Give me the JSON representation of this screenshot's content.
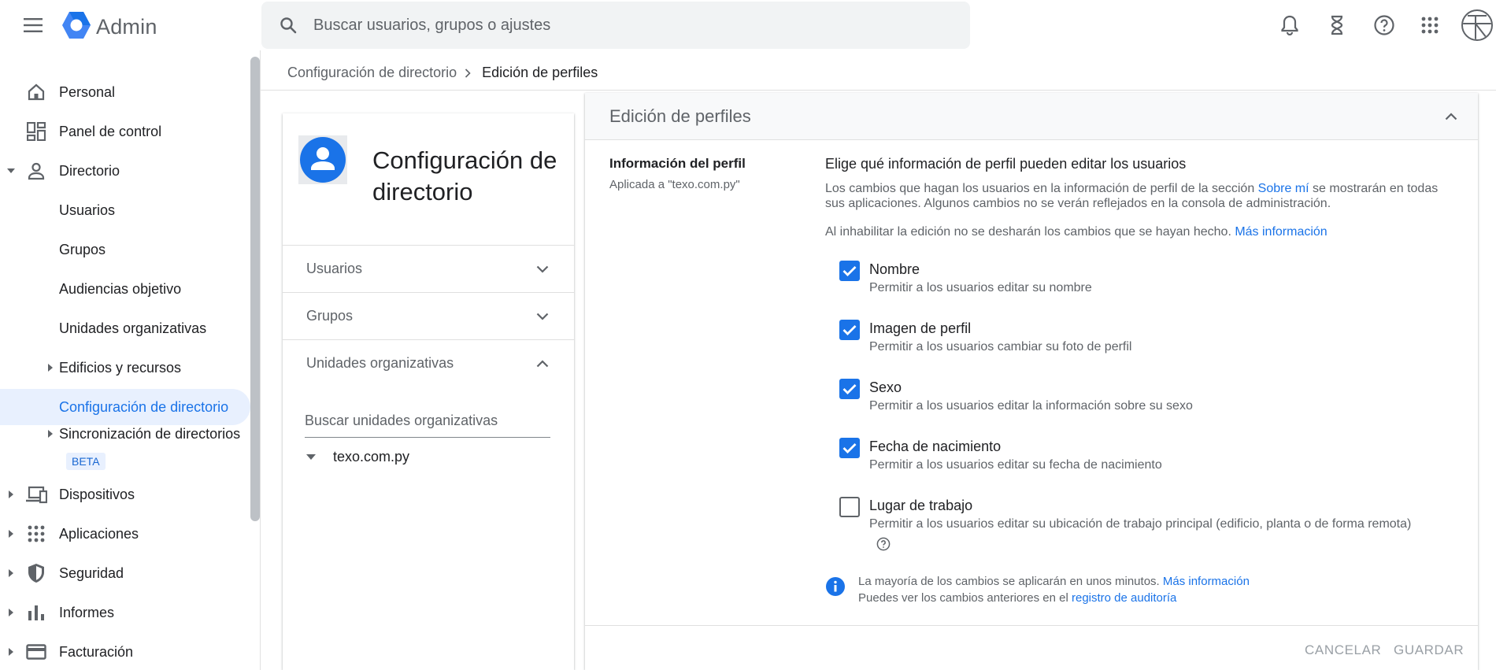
{
  "app": {
    "title": "Admin"
  },
  "search": {
    "placeholder": "Buscar usuarios, grupos o ajustes"
  },
  "sidebar": {
    "items": [
      {
        "label": "Personal"
      },
      {
        "label": "Panel de control"
      },
      {
        "label": "Directorio"
      },
      {
        "label": "Usuarios"
      },
      {
        "label": "Grupos"
      },
      {
        "label": "Audiencias objetivo"
      },
      {
        "label": "Unidades organizativas"
      },
      {
        "label": "Edificios y recursos"
      },
      {
        "label": "Configuración de directorio"
      },
      {
        "label": "Sincronización de directorios",
        "badge": "BETA"
      },
      {
        "label": "Dispositivos"
      },
      {
        "label": "Aplicaciones"
      },
      {
        "label": "Seguridad"
      },
      {
        "label": "Informes"
      },
      {
        "label": "Facturación"
      }
    ]
  },
  "breadcrumb": {
    "parent": "Configuración de directorio",
    "current": "Edición de perfiles"
  },
  "left_card": {
    "title": "Configuración de directorio",
    "sections": [
      {
        "label": "Usuarios"
      },
      {
        "label": "Grupos"
      },
      {
        "label": "Unidades organizativas"
      }
    ],
    "ou_search_placeholder": "Buscar unidades organizativas",
    "ou_root": "texo.com.py"
  },
  "panel": {
    "title": "Edición de perfiles",
    "setting_name": "Información del perfil",
    "setting_applied": "Aplicada a \"texo.com.py\"",
    "heading": "Elige qué información de perfil pueden editar los usuarios",
    "desc_before_link": "Los cambios que hagan los usuarios en la información de perfil de la sección ",
    "desc_link": "Sobre mí",
    "desc_after_link": " se mostrarán en todas sus aplicaciones. Algunos cambios no se verán reflejados en la consola de administración.",
    "desc2_text": "Al inhabilitar la edición no se desharán los cambios que se hayan hecho. ",
    "desc2_link": "Más información",
    "options": [
      {
        "label": "Nombre",
        "description": "Permitir a los usuarios editar su nombre",
        "checked": true
      },
      {
        "label": "Imagen de perfil",
        "description": "Permitir a los usuarios cambiar su foto de perfil",
        "checked": true
      },
      {
        "label": "Sexo",
        "description": "Permitir a los usuarios editar la información sobre su sexo",
        "checked": true
      },
      {
        "label": "Fecha de nacimiento",
        "description": "Permitir a los usuarios editar su fecha de nacimiento",
        "checked": true
      },
      {
        "label": "Lugar de trabajo",
        "description": "Permitir a los usuarios editar su ubicación de trabajo principal (edificio, planta o de forma remota)",
        "checked": false
      }
    ],
    "info_line1": "La mayoría de los cambios se aplicarán en unos minutos. ",
    "info_line1_link": "Más información",
    "info_line2": "Puedes ver los cambios anteriores en el ",
    "info_line2_link": "registro de auditoría",
    "cancel_label": "CANCELAR",
    "save_label": "GUARDAR"
  },
  "colors": {
    "accent": "#1a73e8",
    "active_bg": "#e8f0fe",
    "text_secondary": "#5f6368"
  },
  "icons": {
    "menu": "menu-icon",
    "logo": "admin-hexagon-icon",
    "search": "search-icon",
    "notifications": "bell-icon",
    "tasks": "hourglass-icon",
    "help": "help-icon",
    "apps": "apps-grid-icon"
  }
}
